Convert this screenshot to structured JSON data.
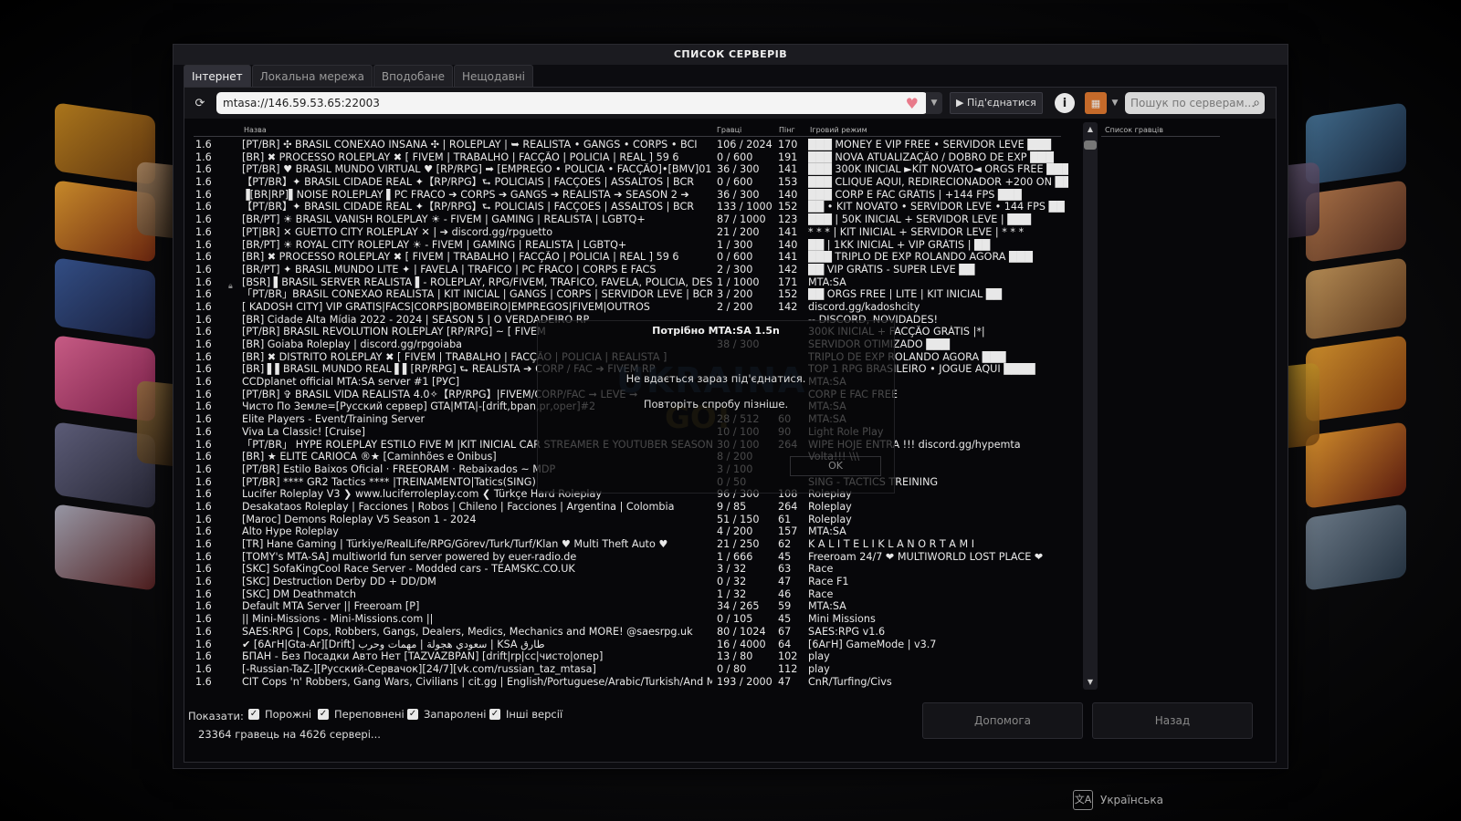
{
  "window": {
    "title": "СПИСОК СЕРВЕРІВ"
  },
  "tabs": [
    {
      "label": "Інтернет",
      "active": true
    },
    {
      "label": "Локальна мережа",
      "active": false
    },
    {
      "label": "Вподобане",
      "active": false
    },
    {
      "label": "Нещодавні",
      "active": false
    }
  ],
  "toolbar": {
    "address_value": "mtasa://146.59.53.65:22003",
    "connect_label": "Під'єднатися",
    "search_placeholder": "Пошук по серверам...",
    "icons": {
      "refresh": "refresh-icon",
      "favorite": "heart-icon",
      "info": "info-icon",
      "filter": "filter-icon",
      "search": "search-icon"
    }
  },
  "list": {
    "headers": {
      "name": "Назва",
      "players": "Гравці",
      "ping": "Пінг",
      "mode": "Ігровий режим"
    },
    "rows": [
      {
        "ver": "1.6",
        "name": "[PT/BR] ✣ BRASIL CONEXAO INSANA ✣ | ROLEPLAY | ➥ REALISTA • GANGS • CORPS • BCI",
        "players": "106 / 2024",
        "ping": "170",
        "mode": "███ MONEY E VIP FREE • SERVIDOR LEVE ███"
      },
      {
        "ver": "1.6",
        "name": "[BR] ✖ PROCESSO ROLEPLAY ✖ [ FIVEM | TRABALHO | FACÇÃO | POLICIA | REAL ]        59  6",
        "players": "0 / 600",
        "ping": "191",
        "mode": "███ NOVA ATUALIZAÇÃO / DOBRO DE EXP ███"
      },
      {
        "ver": "1.6",
        "name": "[PT/BR] ♥ BRASIL MUNDO VIRTUAL ♥ [RP/RPG] ➡ [EMPREGO • POLICIA • FACÇÃO]•[BMV]01",
        "players": "36 / 300",
        "ping": "141",
        "mode": "███ 300K INICIAL ►KIT NOVATO◄ ORGS FREE ███"
      },
      {
        "ver": "1.6",
        "name": "【PT/BR】✦ BRASIL CIDADE REAL ✦【RP/RPG】⮑ POLICIAIS | FACÇÕES | ASSALTOS | BCR",
        "players": "0 / 600",
        "ping": "153",
        "mode": "███ CLIQUE AQUI, REDIRECIONADOR +200 ON ██"
      },
      {
        "ver": "1.6",
        "name": "▐[BR|RP]▌NOISE ROLEPLAY ▌PC FRACO ➔ CORPS ➔ GANGS ➔ REALISTA ➔ SEASON 2  ➔",
        "players": "36 / 300",
        "ping": "140",
        "mode": "███ CORP E FAC GRÁTIS | +144 FPS ███"
      },
      {
        "ver": "1.6",
        "name": "【PT/BR】✦ BRASIL CIDADE REAL ✦【RP/RPG】⮑ POLICIAIS | FACÇÕES | ASSALTOS | BCR",
        "players": "133 / 1000",
        "ping": "152",
        "mode": "██ • KIT NOVATO • SERVIDOR LEVE • 144 FPS ██"
      },
      {
        "ver": "1.6",
        "name": "[BR/PT] ☀ BRASIL VANISH ROLEPLAY ☀ - FIVEM | GAMING | REALISTA | LGBTQ+",
        "players": "87 / 1000",
        "ping": "123",
        "mode": "███ | 50K INICIAL + SERVIDOR LEVE | ███"
      },
      {
        "ver": "1.6",
        "name": "[PT|BR] ✕ GUETTO CITY ROLEPLAY ✕ | ➔ discord.gg/rpguetto",
        "players": "21 / 200",
        "ping": "141",
        "mode": "* * * | KIT INICIAL + SERVIDOR LEVE | * * *"
      },
      {
        "ver": "1.6",
        "name": "[BR/PT] ☀ ROYAL CITY ROLEPLAY ☀ - FIVEM | GAMING | REALISTA | LGBTQ+",
        "players": "1 / 300",
        "ping": "140",
        "mode": "██ | 1KK INICIAL + VIP GRÁTIS | ██"
      },
      {
        "ver": "1.6",
        "name": " [BR] ✖ PROCESSO ROLEPLAY ✖ [ FIVEM | TRABALHO | FACÇÃO | POLICIA | REAL ]        59  6",
        "players": "0 / 600",
        "ping": "141",
        "mode": "███ TRIPLO DE EXP ROLANDO AGORA ███"
      },
      {
        "ver": "1.6",
        "name": "[BR/PT] ✦ BRASIL MUNDO LITE ✦ | FAVELA | TRAFICO | PC FRACO | CORPS E FACS",
        "players": "2 / 300",
        "ping": "142",
        "mode": "██ VIP GRÁTIS - SUPER LEVE ██"
      },
      {
        "ver": "1.6",
        "name": "[BSR] ▌BRASIL SERVER REALISTA ▌- ROLEPLAY, RPG/FIVEM, TRAFICO, FAVELA, POLICIA, DESN",
        "players": "1 / 1000",
        "ping": "171",
        "mode": "MTA:SA"
      },
      {
        "ver": "1.6",
        "name": "「PT/BR」BRASIL CONEXAO REALISTA | KIT INICIAL | GANGS | CORPS | SERVIDOR LEVE | BCR",
        "players": "3 / 200",
        "ping": "152",
        "mode": "██ ORGS FREE | LITE | KIT INICIAL ██"
      },
      {
        "ver": "1.6",
        "name": "[ KADOSH CITY] VIP GRATIS|FACS|CORPS|BOMBEIRO|EMPREGOS|FIVEM|OUTROS",
        "players": "2 / 200",
        "ping": "142",
        "mode": "discord.gg/kadoshcity"
      },
      {
        "ver": "1.6",
        "name": "[BR] Cidade Alta Mídia 2022 - 2024 | SEASON 5 | O VERDADEIRO RP",
        "players": "",
        "ping": "",
        "mode": "-- DISCORD, NOVIDADES!"
      },
      {
        "ver": "1.6",
        "name": "[PT/BR] BRASIL REVOLUTION ROLEPLAY [RP/RPG] ~ [ FIVEM",
        "players": "",
        "ping": "",
        "mode": "300K INICIAL + FACÇÃO GRÁTIS |*|"
      },
      {
        "ver": "1.6",
        "name": "[BR] Goiaba Roleplay | discord.gg/rpgoiaba",
        "players": "38 / 300",
        "ping": "",
        "mode": "SERVIDOR OTIMIZADO ███"
      },
      {
        "ver": "1.6",
        "name": "[BR] ✖ DISTRITO ROLEPLAY ✖ [ FIVEM | TRABALHO | FACÇÃO | POLICIA | REALISTA ]",
        "players": "",
        "ping": "",
        "mode": "TRIPLO DE EXP ROLANDO AGORA ███"
      },
      {
        "ver": "1.6",
        "name": "[BR] ▌▌BRASIL MUNDO REAL ▌▌[RP/RPG] ⮑ REALISTA ➔ CORP / FAC ➔ FIVEM RP",
        "players": "",
        "ping": "",
        "mode": "TOP 1 RPG BRASILEIRO • JOGUE AQUI ████"
      },
      {
        "ver": "1.6",
        "name": "CCDplanet official MTA:SA server #1 [РУС]",
        "players": "",
        "ping": "",
        "mode": "MTA:SA"
      },
      {
        "ver": "1.6",
        "name": "[PT/BR] ✞ BRASIL VIDA REALISTA 4.0✧【RP/RPG】|FIVEM/CORP/FAC ➞ LEVE ➞",
        "players": "",
        "ping": "",
        "mode": "CORP E FAC FREE"
      },
      {
        "ver": "1.6",
        "name": "Чисто По Земле=[Русский сервер] GTA|MTA|-[drift,bpan,pr,oper]#2",
        "players": "",
        "ping": "",
        "mode": "MTA:SA"
      },
      {
        "ver": "1.6",
        "name": "Elite Players - Event/Training Server",
        "players": "28 / 512",
        "ping": "60",
        "mode": "MTA:SA"
      },
      {
        "ver": "1.6",
        "name": "Viva La Classic! [Cruise]",
        "players": "10 / 100",
        "ping": "90",
        "mode": "Light Role Play"
      },
      {
        "ver": "1.6",
        "name": "「PT/BR」 HYPE ROLEPLAY ESTILO FIVE M |KIT INICIAL CAR STREAMER E YOUTUBER SEASON 5",
        "players": "30 / 100",
        "ping": "264",
        "mode": "WIPE HOJE ENTRA !!! discord.gg/hypemta"
      },
      {
        "ver": "1.6",
        "name": "[BR]      ★ ELITE CARIOCA ®★      [Caminhões e Onibus]",
        "players": "8 / 200",
        "ping": "",
        "mode": "Volta!!! \\\\\\"
      },
      {
        "ver": "1.6",
        "name": "[PT/BR] Estilo Baixos Oficial · FREEORAM · Rebaixados ~ MDP",
        "players": "3 / 100",
        "ping": "",
        "mode": ""
      },
      {
        "ver": "1.6",
        "name": "[PT/BR] **** GR2 Tactics **** |TREINAMENTO|Tatics(SING)",
        "players": "0 / 50",
        "ping": "",
        "mode": "SING - TACTICS TREINING"
      },
      {
        "ver": "1.6",
        "name": "Lucifer Roleplay V3 ❯ www.luciferroleplay.com ❮ Türkçe Hard Roleplay",
        "players": "96 / 300",
        "ping": "108",
        "mode": "Roleplay"
      },
      {
        "ver": "1.6",
        "name": "Desakataos Roleplay | Facciones | Robos | Chileno | Facciones | Argentina | Colombia",
        "players": "9 / 85",
        "ping": "264",
        "mode": "Roleplay"
      },
      {
        "ver": "1.6",
        "name": "[Maroc] Demons Roleplay V5 Season 1 - 2024",
        "players": "51 / 150",
        "ping": "61",
        "mode": "Roleplay"
      },
      {
        "ver": "1.6",
        "name": "Alto Hype Roleplay",
        "players": "4 / 200",
        "ping": "157",
        "mode": "MTA:SA"
      },
      {
        "ver": "1.6",
        "name": "[TR]   Hane Gaming   | Türkiye/RealLife/RPG/Görev/Turk/Turf/Klan    ♥ Multi Theft Auto ♥",
        "players": "21 / 250",
        "ping": "62",
        "mode": "K A L I T E L I  K L A N  O R T A M I"
      },
      {
        "ver": "1.6",
        "name": "[TOMY's MTA-SA] multiworld fun server powered by euer-radio.de",
        "players": "1 / 666",
        "ping": "45",
        "mode": "Freeroam 24/7 ❤ MULTIWORLD LOST PLACE ❤"
      },
      {
        "ver": "1.6",
        "name": "[SKC] SofaKingCool Race Server - Modded cars - TEAMSKC.CO.UK",
        "players": "3 / 32",
        "ping": "63",
        "mode": "Race"
      },
      {
        "ver": "1.6",
        "name": "[SKC] Destruction Derby DD + DD/DM",
        "players": "0 / 32",
        "ping": "47",
        "mode": "Race F1"
      },
      {
        "ver": "1.6",
        "name": "[SKC] DM Deathmatch",
        "players": "1 / 32",
        "ping": "46",
        "mode": "Race"
      },
      {
        "ver": "1.6",
        "name": "Default MTA Server || Freeroam [P]",
        "players": "34 / 265",
        "ping": "59",
        "mode": "MTA:SA"
      },
      {
        "ver": "1.6",
        "name": "|| Mini-Missions - Mini-Missions.com ||",
        "players": "0 / 105",
        "ping": "45",
        "mode": "Mini Missions"
      },
      {
        "ver": "1.6",
        "name": "SAES:RPG | Cops, Robbers, Gangs, Dealers, Medics, Mechanics and MORE! @saesrpg.uk",
        "players": "80 / 1024",
        "ping": "67",
        "mode": "SAES:RPG v1.6"
      },
      {
        "ver": "1.6",
        "name": "✔ [6AгH|Gta-Ar][Drift] سعودي هجولة | مهمات وحرب | KSA طارق",
        "players": "16 / 4000",
        "ping": "64",
        "mode": "[6AгH] GameMode | v3.7"
      },
      {
        "ver": "1.6",
        "name": "БПАН - Без Посадки Авто Нет [TAZVAZBPAN] [drift|rp|cc|чисто|опер]",
        "players": "13 / 80",
        "ping": "102",
        "mode": "play"
      },
      {
        "ver": "1.6",
        "name": "[-Russian-TaZ-][Русский-Сервачок][24/7][vk.com/russian_taz_mtasa]",
        "players": "0 / 80",
        "ping": "112",
        "mode": "play"
      },
      {
        "ver": "1.6",
        "name": "CIT Cops 'n' Robbers, Gang Wars, Civilians | cit.gg | English/Portuguese/Arabic/Turkish/And More",
        "players": "193 / 2000",
        "ping": "47",
        "mode": "CnR/Turfing/Civs"
      }
    ]
  },
  "players_panel": {
    "header": "Список гравців"
  },
  "bottom": {
    "show_label": "Показати:",
    "checkboxes": [
      {
        "label": "Порожні",
        "checked": true
      },
      {
        "label": "Переповнені",
        "checked": true
      },
      {
        "label": "Запаролені",
        "checked": true
      },
      {
        "label": "Інші версії",
        "checked": true
      }
    ],
    "status": "23364 гравець на 4626 сервері...",
    "help_label": "Допомога",
    "back_label": "Назад"
  },
  "dialog": {
    "title": "Потрібно MTA:SA 1.5n",
    "message1": "Не вдається зараз під'єднатися.",
    "message2": "Повторіть спробу пізніше.",
    "ok_label": "OK"
  },
  "language": {
    "label": "Українська"
  }
}
